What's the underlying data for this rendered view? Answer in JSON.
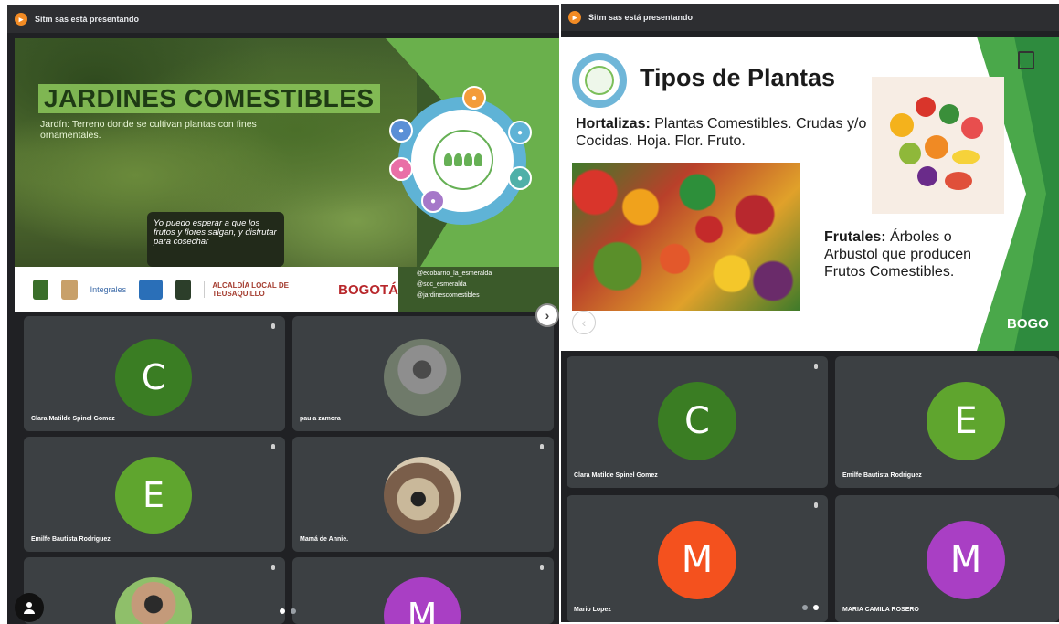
{
  "left_window": {
    "presenter_banner": "Sitm sas está presentando",
    "slide": {
      "title": "JARDINES COMESTIBLES",
      "definition": "Jardín: Terreno donde se cultivan plantas con fines ornamentales.",
      "sign_text": "Yo puedo esperar a que los frutos y flores salgan, y disfrutar para cosechar",
      "footer": {
        "integrales": "Integrales",
        "alcaldia": "ALCALDÍA LOCAL DE TEUSAQUILLO",
        "bogota": "BOGOTÁ"
      },
      "social": [
        "@ecobarrio_la_esmeralda",
        "@soc_esmeralda",
        "@jardinescomestibles"
      ]
    },
    "participants": [
      {
        "name": "Clara Matilde Spinel Gomez",
        "initial": "C",
        "color": "#3a7d23"
      },
      {
        "name": "paula zamora",
        "initial": "",
        "color": "#6b6b6b"
      },
      {
        "name": "Emilfe Bautista Rodriguez",
        "initial": "E",
        "color": "#5fa52e"
      },
      {
        "name": "Mamá de Annie.",
        "initial": "",
        "color": "#6b6b6b"
      },
      {
        "name": "",
        "initial": "",
        "color": "#6b6b6b"
      },
      {
        "name": "",
        "initial": "M",
        "color": "#a93fc4"
      }
    ]
  },
  "right_window": {
    "presenter_banner": "Sitm sas está presentando",
    "slide": {
      "title": "Tipos de Plantas",
      "hortalizas_label": "Hortalizas:",
      "hortalizas_text": " Plantas Comestibles. Crudas y/o Cocidas. Hoja. Flor. Fruto.",
      "frutales_label": "Frutales:",
      "frutales_text": " Árboles o Arbustol que producen Frutos Comestibles.",
      "brand": "BOGO"
    },
    "participants": [
      {
        "name": "Clara Matilde Spinel Gomez",
        "initial": "C",
        "color": "#3a7d23"
      },
      {
        "name": "Emilfe Bautista Rodriguez",
        "initial": "E",
        "color": "#5fa52e"
      },
      {
        "name": "Mario Lopez",
        "initial": "M",
        "color": "#f4511e"
      },
      {
        "name": "MARIA CAMILA ROSERO",
        "initial": "M",
        "color": "#a93fc4"
      }
    ]
  },
  "icons": {
    "presenter": "present-icon",
    "next": "chevron-right-icon",
    "prev": "chevron-left-icon",
    "mic": "mic-icon",
    "user": "person-icon"
  }
}
